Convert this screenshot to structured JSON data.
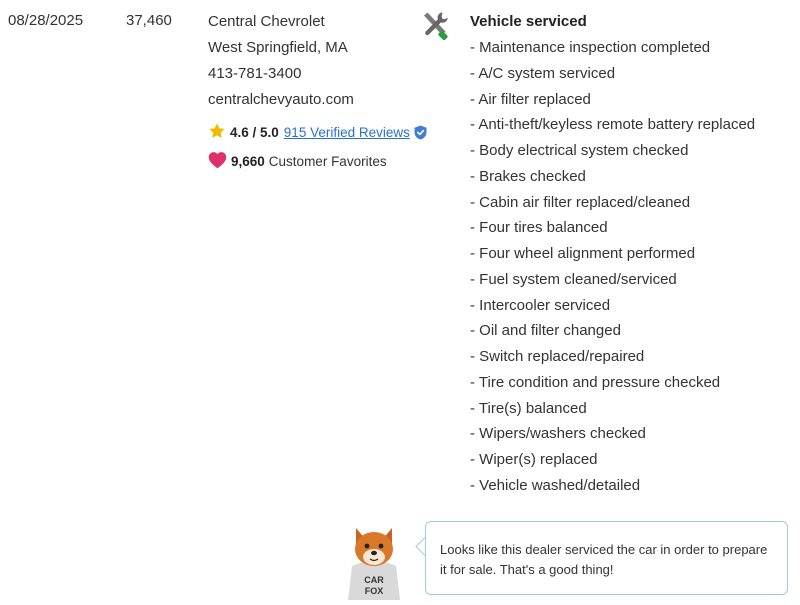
{
  "record": {
    "date": "08/28/2025",
    "odometer": "37,460",
    "dealer": {
      "name": "Central Chevrolet",
      "location": "West Springfield, MA",
      "phone": "413-781-3400",
      "website": "centralchevyauto.com",
      "rating": "4.6 / 5.0",
      "reviews_link": "915 Verified Reviews",
      "favorites_count": "9,660",
      "favorites_label": "Customer Favorites"
    },
    "service": {
      "title": "Vehicle serviced",
      "items": [
        "- Maintenance inspection completed",
        "- A/C system serviced",
        "- Air filter replaced",
        "- Anti-theft/keyless remote battery replaced",
        "- Body electrical system checked",
        "- Brakes checked",
        "- Cabin air filter replaced/cleaned",
        "- Four tires balanced",
        "- Four wheel alignment performed",
        "- Fuel system cleaned/serviced",
        "- Intercooler serviced",
        "- Oil and filter changed",
        "- Switch replaced/repaired",
        "- Tire condition and pressure checked",
        "- Tire(s) balanced",
        "- Wipers/washers checked",
        "- Wiper(s) replaced",
        "- Vehicle washed/detailed"
      ]
    }
  },
  "tip": {
    "text": "Looks like this dealer serviced the car in order to prepare it for sale. That's a good thing!",
    "mascot_shirt_line1": "CAR",
    "mascot_shirt_line2": "FOX"
  },
  "icons": {
    "service": "wrench-screwdriver-icon",
    "rating": "star-icon",
    "verified": "verified-badge-icon",
    "favorites": "heart-icon"
  },
  "colors": {
    "link": "#2b6fcf",
    "star": "#f5b800",
    "heart": "#e0306a",
    "verified": "#3d7fd6",
    "bubble_border": "#9fcbdc"
  }
}
